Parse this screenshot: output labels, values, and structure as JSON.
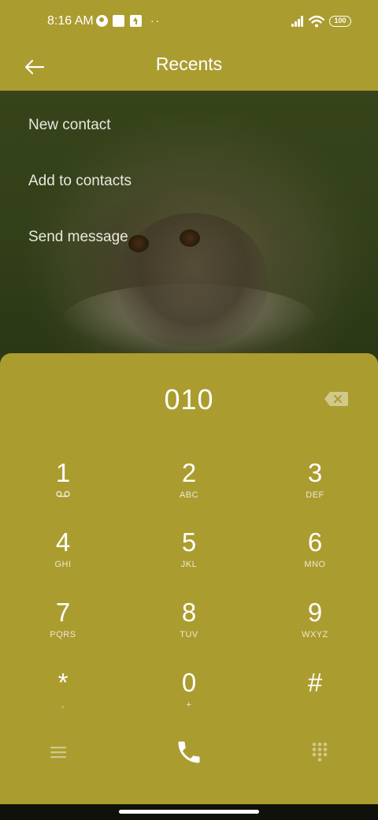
{
  "status_bar": {
    "time": "8:16 AM",
    "dots": "··",
    "battery": "100"
  },
  "header": {
    "title": "Recents"
  },
  "menu": {
    "items": [
      {
        "label": "New contact"
      },
      {
        "label": "Add to contacts"
      },
      {
        "label": "Send message"
      }
    ]
  },
  "dialer": {
    "number": "010",
    "keys": [
      {
        "digit": "1",
        "letters": ""
      },
      {
        "digit": "2",
        "letters": "ABC"
      },
      {
        "digit": "3",
        "letters": "DEF"
      },
      {
        "digit": "4",
        "letters": "GHI"
      },
      {
        "digit": "5",
        "letters": "JKL"
      },
      {
        "digit": "6",
        "letters": "MNO"
      },
      {
        "digit": "7",
        "letters": "PQRS"
      },
      {
        "digit": "8",
        "letters": "TUV"
      },
      {
        "digit": "9",
        "letters": "WXYZ"
      },
      {
        "digit": "*",
        "letters": ","
      },
      {
        "digit": "0",
        "letters": "+"
      },
      {
        "digit": "#",
        "letters": ""
      }
    ]
  },
  "icons": {
    "back": "arrow-left-icon",
    "backspace": "backspace-icon",
    "voicemail": "voicemail-icon",
    "menu": "hamburger-menu-icon",
    "call": "phone-icon",
    "keypad": "dialpad-icon"
  },
  "colors": {
    "accent": "#ab9c2f",
    "text": "#ffffff"
  }
}
